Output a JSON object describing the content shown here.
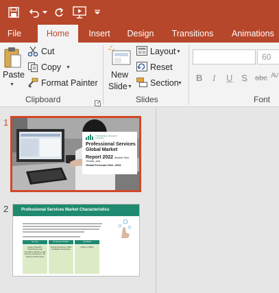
{
  "ribbon_tabs": {
    "file": "File",
    "home": "Home",
    "insert": "Insert",
    "design": "Design",
    "transitions": "Transitions",
    "animations": "Animations"
  },
  "clipboard": {
    "paste": "Paste",
    "cut": "Cut",
    "copy": "Copy",
    "format_painter": "Format Painter",
    "group_label": "Clipboard"
  },
  "slides_group": {
    "new_slide_line1": "New",
    "new_slide_line2": "Slide",
    "layout": "Layout",
    "reset": "Reset",
    "section": "Section",
    "group_label": "Slides"
  },
  "font_group": {
    "size": "60",
    "bold": "B",
    "italic": "I",
    "underline": "U",
    "shadow": "S",
    "strikethrough": "abc",
    "spacing": "AV",
    "group_label": "Font"
  },
  "slides": [
    {
      "number": "1",
      "logo": "The Business Research Company",
      "title_line1": "Professional Services",
      "title_line2": "Global Market",
      "title_line3a": "Report 2022 ",
      "title_line3b": "Market Size,",
      "title_line4": "Trends, and",
      "title_line5": "Global Forecast 2022 -2026"
    },
    {
      "number": "2",
      "title": "Professional Services Market Characteristics",
      "table_headers": [
        "By Type",
        "By Service Provider",
        "By Model"
      ],
      "col1": "Design, Research, Professional Legal Consulting, Advisory, Legal Services, Architecture, Tax Systems, Performance",
      "col2": "Private Enterprises, Public and Medium Enterprises",
      "col3": "Online or Offline"
    }
  ],
  "colors": {
    "brand": "#b7472a",
    "selected_border": "#d24726",
    "slide2_banner": "#1f8a6f"
  }
}
